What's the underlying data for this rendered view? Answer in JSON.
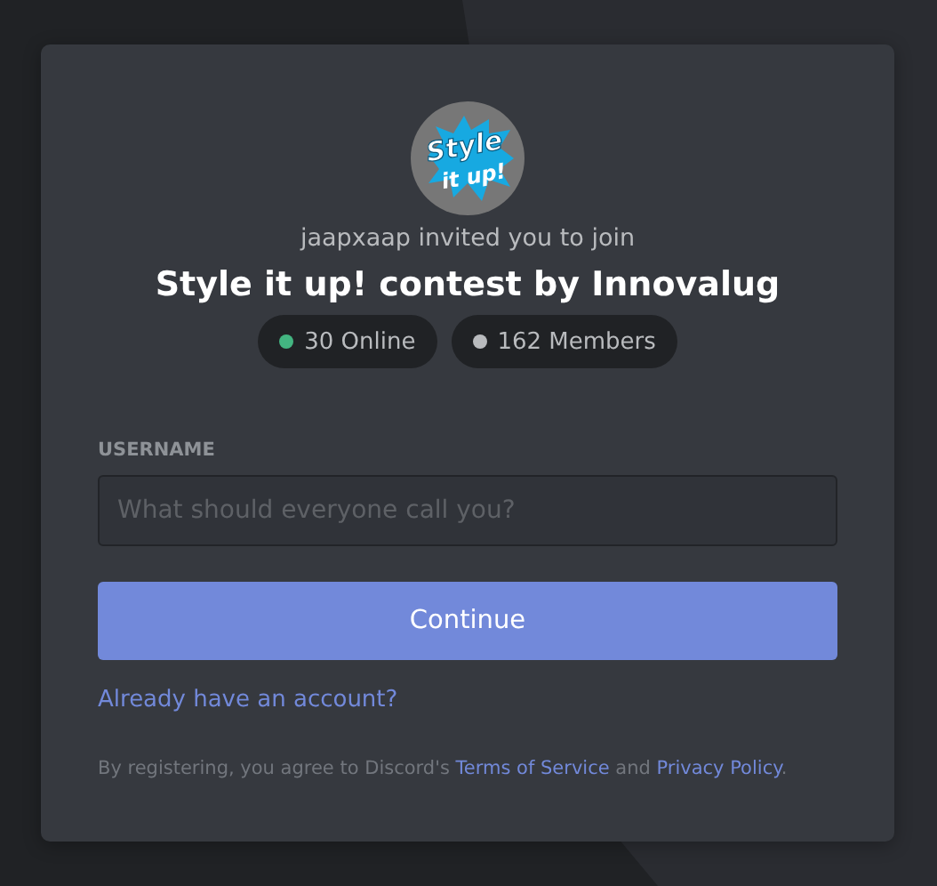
{
  "server": {
    "logo_lines": [
      "Style",
      "it up!"
    ],
    "inviter_text": "jaapxaap invited you to join",
    "name": "Style it up! contest by Innovalug"
  },
  "stats": [
    {
      "label": "30 Online",
      "color": "#43b581"
    },
    {
      "label": "162 Members",
      "color": "#b9bbbe"
    }
  ],
  "form": {
    "label": "USERNAME",
    "placeholder": "What should everyone call you?",
    "button": "Continue",
    "login_link": "Already have an account?"
  },
  "legal": [
    {
      "kind": "text",
      "text": "By registering, you agree to Discord's "
    },
    {
      "kind": "link",
      "text": "Terms of Service"
    },
    {
      "kind": "text",
      "text": " and "
    },
    {
      "kind": "link",
      "text": "Privacy Policy"
    },
    {
      "kind": "text",
      "text": "."
    }
  ]
}
